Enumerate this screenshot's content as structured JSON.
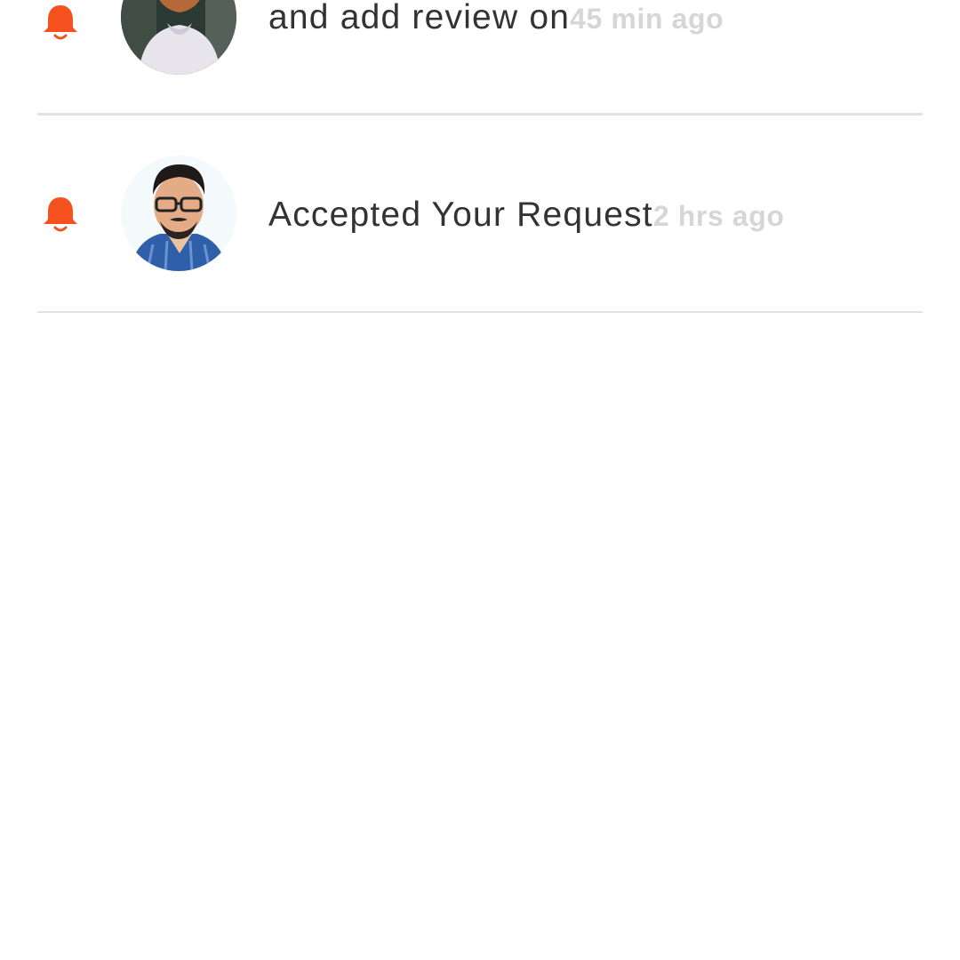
{
  "colors": {
    "accent": "#F4511E",
    "text": "#333333",
    "time": "#D6D6D6",
    "divider": "#E2E2E2"
  },
  "notifications": [
    {
      "icon": "bell-icon",
      "message": "and add review on",
      "time": "45 min ago"
    },
    {
      "icon": "bell-icon",
      "message": "Accepted Your Request",
      "time": "2 hrs ago"
    }
  ]
}
